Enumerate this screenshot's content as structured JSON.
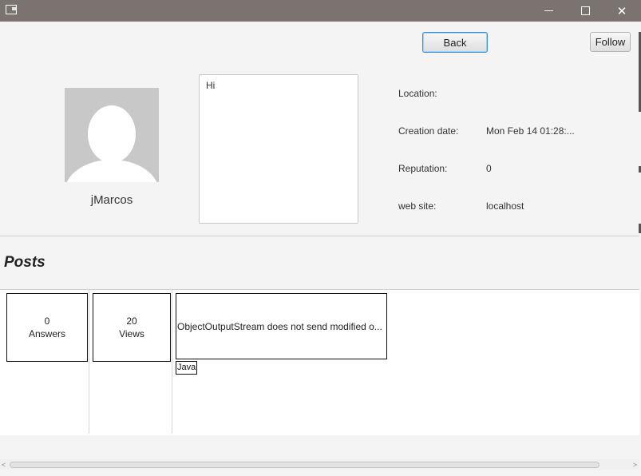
{
  "titlebar": {
    "icons": {
      "app": "app-window-icon",
      "minimize": "minimize-icon",
      "maximize": "maximize-icon",
      "close": "close-icon"
    },
    "close_glyph": "✕",
    "bg_color": "#7a7370"
  },
  "header": {
    "back_label": "Back",
    "follow_label": "Follow"
  },
  "profile": {
    "avatar_icon": "user-avatar-placeholder-icon",
    "username": "jMarcos",
    "bio": "Hi"
  },
  "info": {
    "location_label": "Location:",
    "location_value": "",
    "creation_label": "Creation date:",
    "creation_value": "Mon Feb 14 01:28:...",
    "reputation_label": "Reputation:",
    "reputation_value": "0",
    "website_label": "web site:",
    "website_value": "localhost"
  },
  "posts": {
    "heading": "Posts",
    "items": [
      {
        "answers_count": "0",
        "answers_label": "Answers",
        "views_count": "20",
        "views_label": "Views",
        "title": "ObjectOutputStream does not send modified o...",
        "tags": [
          "Java"
        ]
      }
    ]
  },
  "scrollbar": {
    "left_arrow": "<",
    "right_arrow": ">"
  }
}
